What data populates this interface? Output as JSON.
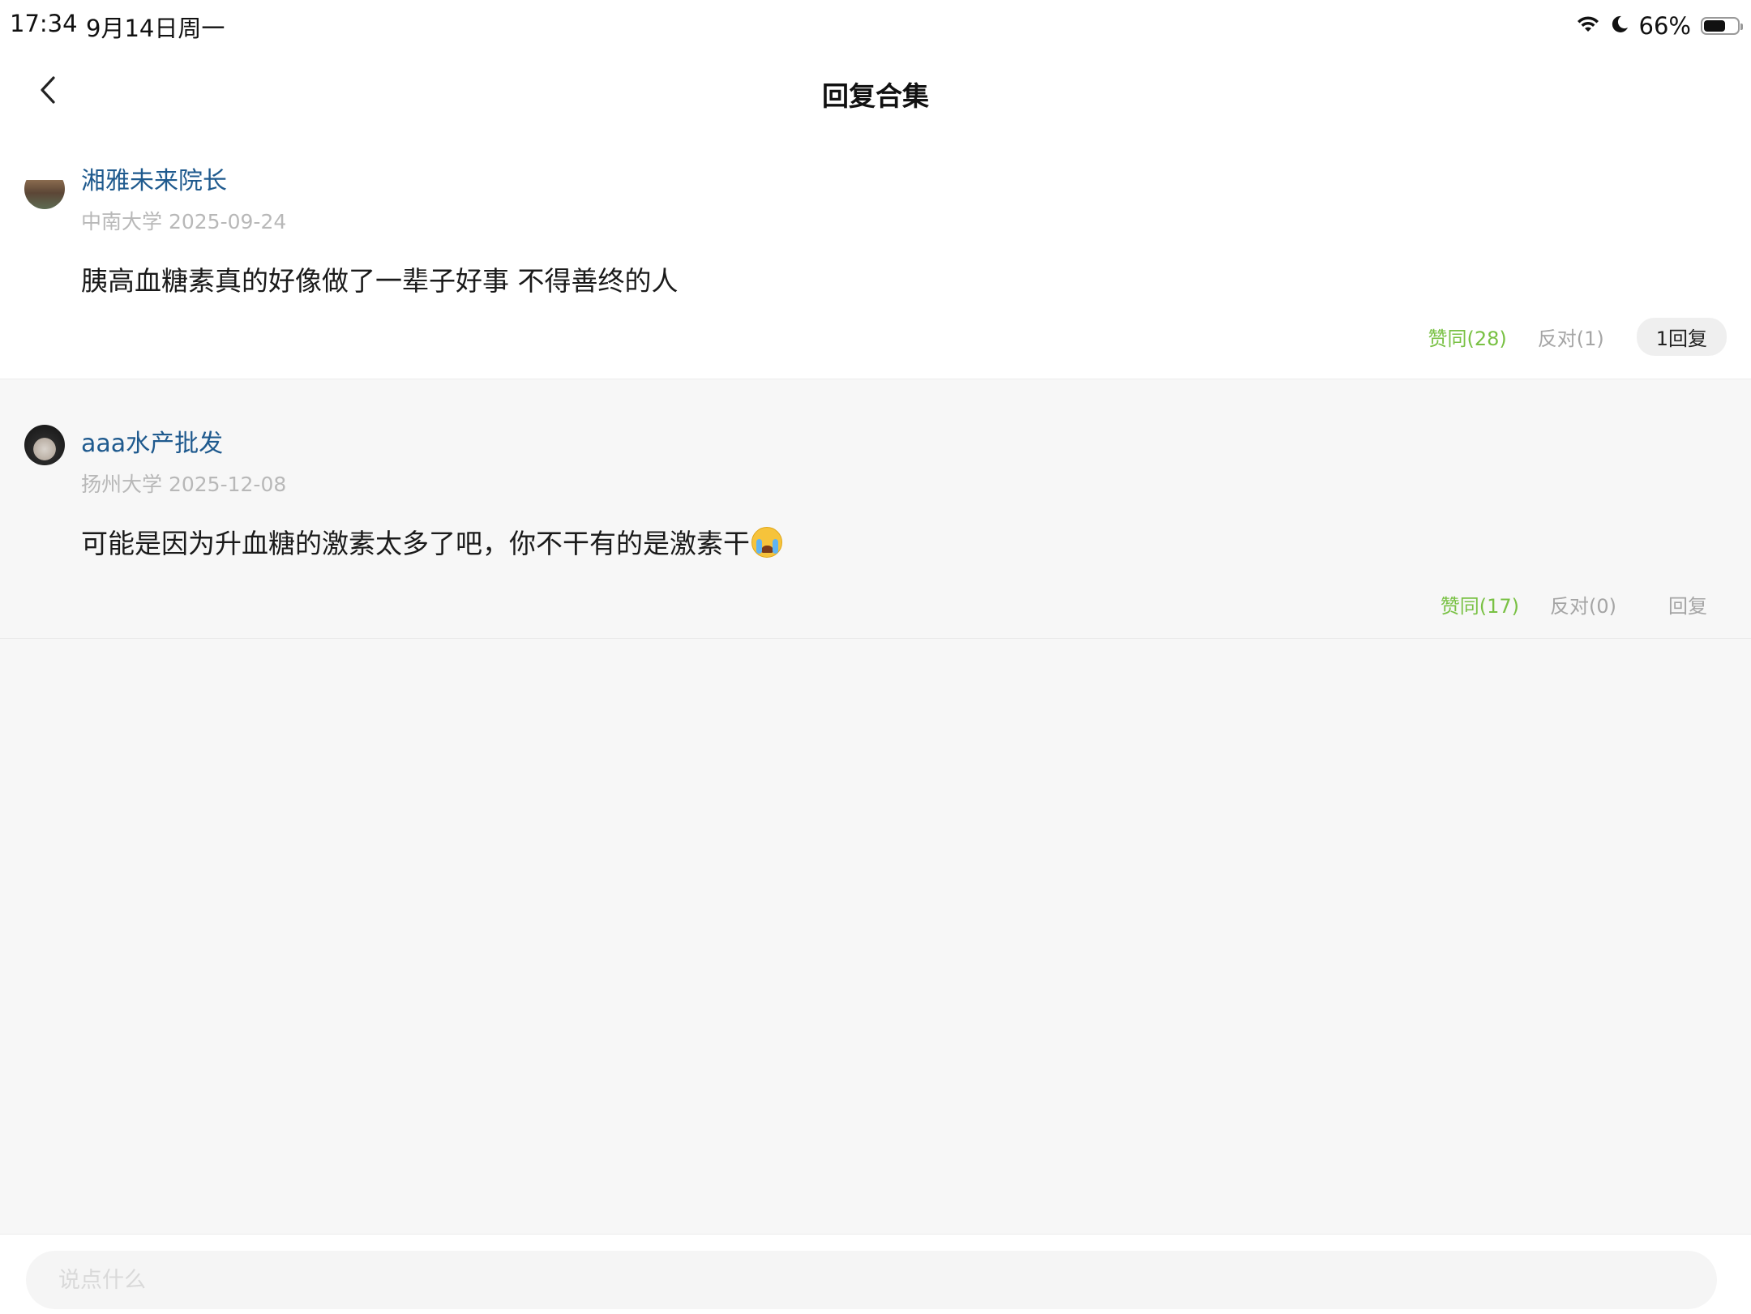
{
  "status_bar": {
    "time": "17:34",
    "date": "9月14日周一",
    "battery_percent": "66%",
    "battery_level": 0.66,
    "wifi_icon": "wifi-icon",
    "focus_icon": "moon-icon"
  },
  "nav": {
    "back_icon": "chevron-left-icon",
    "title": "回复合集"
  },
  "replies": [
    {
      "username": "湘雅未来院长",
      "school": "中南大学",
      "date": "2025-09-24",
      "content": "胰高血糖素真的好像做了一辈子好事 不得善终的人",
      "agree_label": "赞同(28)",
      "oppose_label": "反对(1)",
      "reply_label": "1回复"
    },
    {
      "username": "aaa水产批发",
      "school": "扬州大学",
      "date": "2025-12-08",
      "content": "可能是因为升血糖的激素太多了吧，你不干有的是激素干",
      "emoji": "loudly-crying-face-icon",
      "agree_label": "赞同(17)",
      "oppose_label": "反对(0)",
      "reply_label": "回复"
    }
  ],
  "colors": {
    "username": "#1f5a8e",
    "agree": "#79c144",
    "muted": "#a5a5a5",
    "page_background": "#f7f7f7"
  },
  "comment_bar": {
    "placeholder": "说点什么"
  }
}
